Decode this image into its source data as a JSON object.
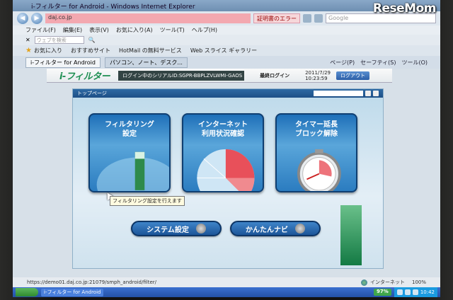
{
  "watermark": "ReseMom",
  "window": {
    "title": "i-フィルター for Android - Windows Internet Explorer"
  },
  "address": {
    "url": "daj.co.jp",
    "cert_error": "証明書のエラー",
    "search_placeholder": "Google"
  },
  "menu": [
    "ファイル(F)",
    "編集(E)",
    "表示(V)",
    "お気に入り(A)",
    "ツール(T)",
    "ヘルプ(H)"
  ],
  "toolbar": {
    "search_placeholder": "ウェブを検索"
  },
  "favorites": {
    "label": "お気に入り",
    "items": [
      "おすすめサイト",
      "HotMail の無料サービス",
      "Web スライス ギャラリー"
    ]
  },
  "tabs": [
    {
      "label": "i-フィルター for Android",
      "active": true
    },
    {
      "label": "パソコン、ノート、デスク...",
      "active": false
    }
  ],
  "tab_tools": [
    "ページ(P)",
    "セーフティ(S)",
    "ツール(O)"
  ],
  "app": {
    "brand": "i-フィルター",
    "serial": "ログイン中のシリアルID:SGPR-BBPLZVLWMI-GAOS",
    "last_login_label": "最終ログイン",
    "last_login_date": "2011/7/29",
    "last_login_time": "10:23:59",
    "logout_label": "ログアウト"
  },
  "panel": {
    "title": "トップページ"
  },
  "tiles": [
    {
      "line1": "フィルタリング",
      "line2": "設定"
    },
    {
      "line1": "インターネット",
      "line2": "利用状況確認"
    },
    {
      "line1": "タイマー延長",
      "line2": "ブロック解除"
    }
  ],
  "tooltip": "フィルタリング設定を行えます",
  "buttons": {
    "system": "システム設定",
    "navi": "かんたんナビ"
  },
  "status": {
    "url": "https://demo01.daj.co.jp:21079/smph_android/filter/",
    "zone": "インターネット",
    "zoom": "100%"
  },
  "taskbar": {
    "task": "i-フィルター for Android",
    "battery": "97%",
    "time": "10:42"
  }
}
